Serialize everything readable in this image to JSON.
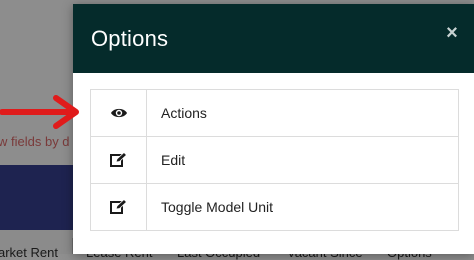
{
  "background": {
    "link_text": "w fields by d",
    "columns": [
      "arket Rent",
      "Lease Rent",
      "Last Occupied",
      "Vacant Since",
      "Options"
    ]
  },
  "modal": {
    "title": "Options",
    "close_icon": "×",
    "items": [
      {
        "label": "Actions",
        "icon": "eye-icon"
      },
      {
        "label": "Edit",
        "icon": "edit-icon"
      },
      {
        "label": "Toggle Model Unit",
        "icon": "edit-icon"
      }
    ]
  },
  "colors": {
    "header": "#052b2b",
    "arrow": "#e01b1b",
    "backdrop_band": "#1e2350"
  }
}
